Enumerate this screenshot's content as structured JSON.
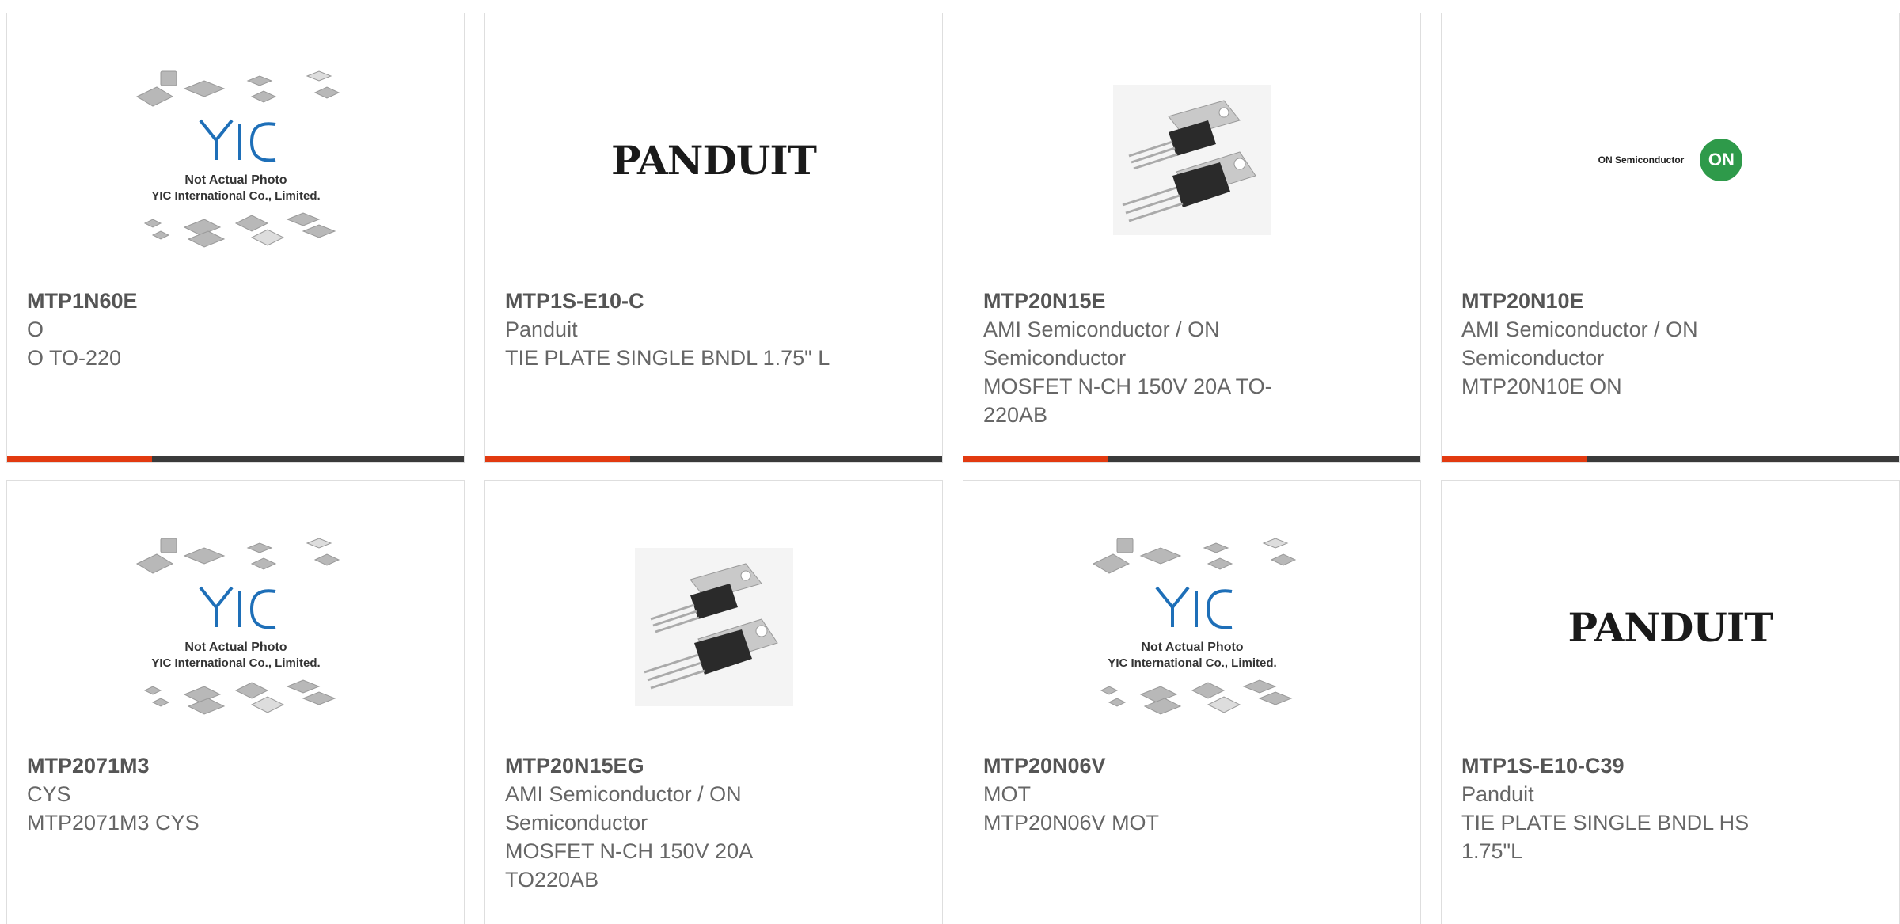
{
  "cards": [
    {
      "part_number": "MTP1N60E",
      "manufacturer": "O",
      "description": "O TO-220",
      "image": "yic-placeholder",
      "image_caption_1": "Not Actual Photo",
      "image_caption_2": "YIC International Co., Limited.",
      "image_logo": "YIC"
    },
    {
      "part_number": "MTP1S-E10-C",
      "manufacturer": "Panduit",
      "description": "TIE PLATE SINGLE BNDL 1.75\" L",
      "image": "panduit-logo",
      "image_logo": "PANDUIT"
    },
    {
      "part_number": "MTP20N15E",
      "manufacturer": "AMI Semiconductor / ON Semiconductor",
      "description": "MOSFET N-CH 150V 20A TO-220AB",
      "image": "to220-transistor"
    },
    {
      "part_number": "MTP20N10E",
      "manufacturer": "AMI Semiconductor / ON Semiconductor",
      "description": "MTP20N10E ON",
      "image": "on-semiconductor-logo",
      "image_logo_text": "ON Semiconductor",
      "image_logo_badge": "ON"
    },
    {
      "part_number": "MTP2071M3",
      "manufacturer": "CYS",
      "description": "MTP2071M3 CYS",
      "image": "yic-placeholder",
      "image_caption_1": "Not Actual Photo",
      "image_caption_2": "YIC International Co., Limited.",
      "image_logo": "YIC"
    },
    {
      "part_number": "MTP20N15EG",
      "manufacturer": "AMI Semiconductor / ON Semiconductor",
      "description": "MOSFET N-CH 150V 20A TO220AB",
      "image": "to220-transistor"
    },
    {
      "part_number": "MTP20N06V",
      "manufacturer": "MOT",
      "description": "MTP20N06V MOT",
      "image": "yic-placeholder",
      "image_caption_1": "Not Actual Photo",
      "image_caption_2": "YIC International Co., Limited.",
      "image_logo": "YIC"
    },
    {
      "part_number": "MTP1S-E10-C39",
      "manufacturer": "Panduit",
      "description": "TIE PLATE SINGLE BNDL HS 1.75\"L",
      "image": "panduit-logo",
      "image_logo": "PANDUIT"
    }
  ],
  "colors": {
    "accent": "#e23a10",
    "bar": "#3a3a3a",
    "text": "#666666",
    "part_number": "#555555",
    "yic_blue": "#1e6fb8",
    "on_green": "#2e9a4a"
  }
}
